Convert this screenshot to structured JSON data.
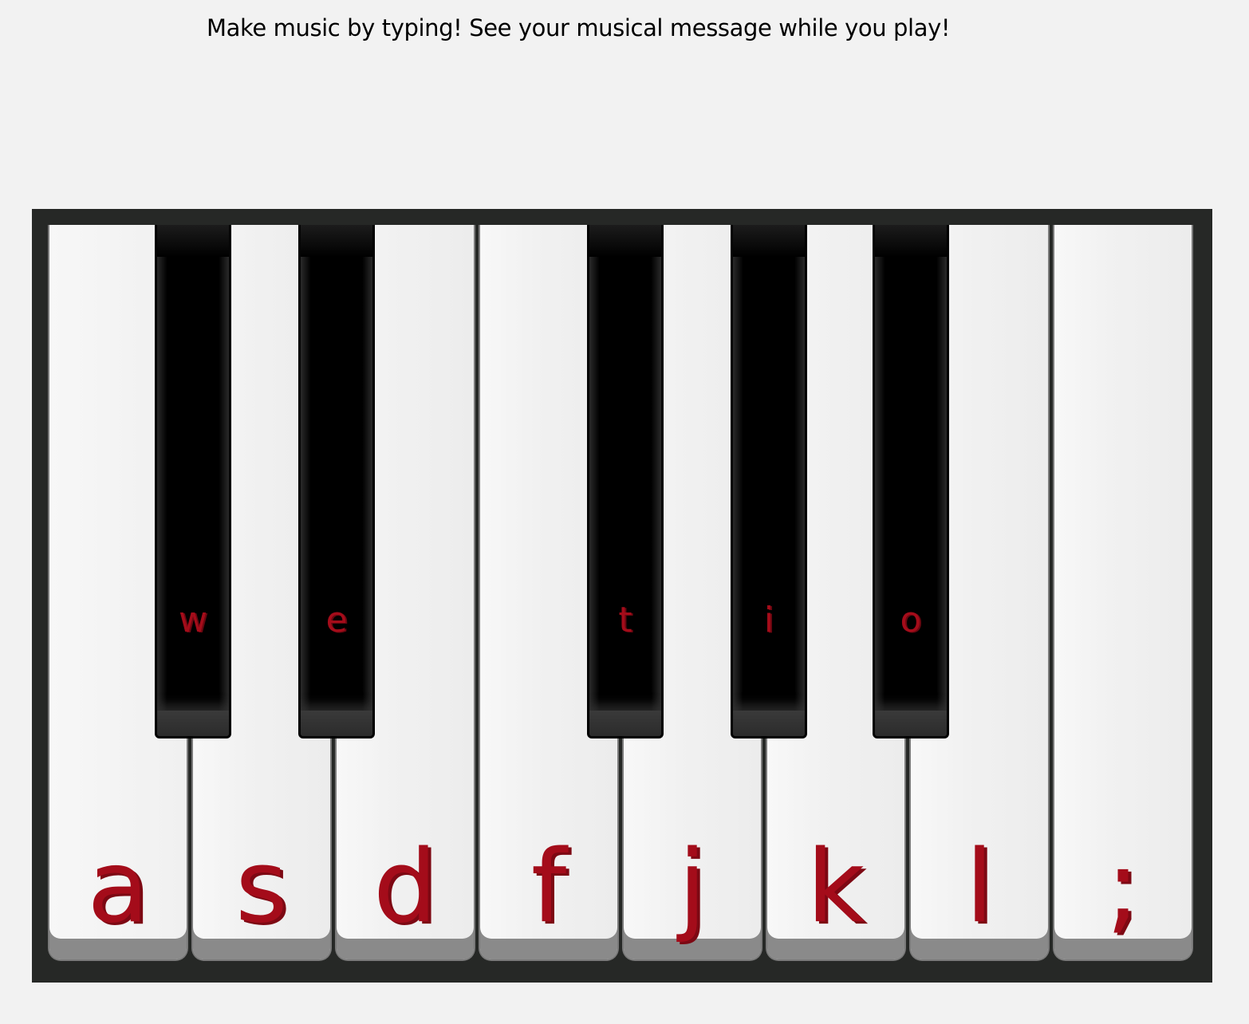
{
  "intro_text": "Make music by typing! See your musical message while you play!",
  "colors": {
    "label": "#a40c1a",
    "piano_frame": "#262826",
    "white_key": "#f2f2f2",
    "black_key": "#000000"
  },
  "white_keys": [
    {
      "label": "a"
    },
    {
      "label": "s"
    },
    {
      "label": "d"
    },
    {
      "label": "f"
    },
    {
      "label": "j"
    },
    {
      "label": "k"
    },
    {
      "label": "l"
    },
    {
      "label": ";"
    }
  ],
  "black_keys": [
    {
      "label": "w"
    },
    {
      "label": "e"
    },
    {
      "label": "t"
    },
    {
      "label": "i"
    },
    {
      "label": "o"
    }
  ]
}
